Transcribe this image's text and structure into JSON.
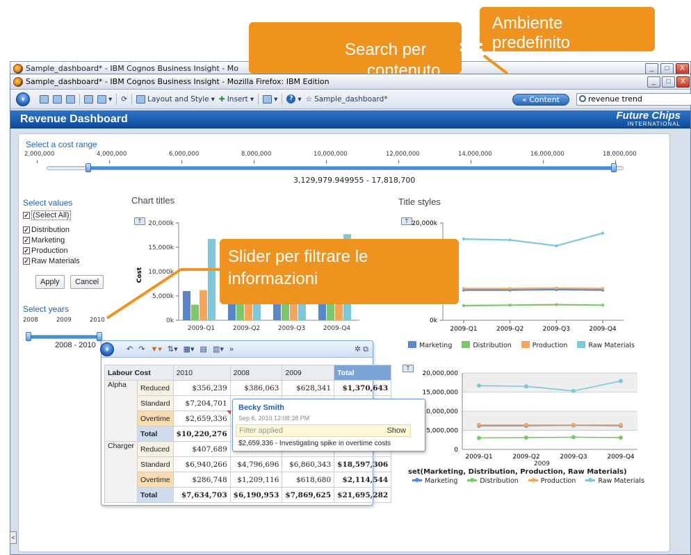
{
  "windows": {
    "back_title": "Sample_dashboard* - IBM Cognos Business Insight - Mo",
    "front_title": "Sample_dashboard* - IBM Cognos Business Insight - Mozilla Firefox: IBM Edition"
  },
  "toolbar": {
    "layout_label": "Layout and Style",
    "insert_label": "Insert",
    "dashboard_name": "Sample_dashboard*",
    "content_label": "« Content",
    "search_value": "revenue trend"
  },
  "dashboard": {
    "title": "Revenue Dashboard",
    "logo_main": "Future Chips",
    "logo_sub": "INTERNATIONAL"
  },
  "cost_range": {
    "label": "Select a cost range",
    "ticks": [
      "2,000,000",
      "4,000,000",
      "6,000,000",
      "8,000,000",
      "10,000,000",
      "12,000,000",
      "14,000,000",
      "16,000,000",
      "18,000,000"
    ],
    "range_text": "3,129,979.949955 - 17,818,700"
  },
  "values_filter": {
    "label": "Select values",
    "items": [
      "(Select All)",
      "Distribution",
      "Marketing",
      "Production",
      "Raw Materials"
    ],
    "apply": "Apply",
    "cancel": "Cancel"
  },
  "years_filter": {
    "label": "Select years",
    "ticks": [
      "2008",
      "2009",
      "2010"
    ],
    "range_text": "2008 - 2010"
  },
  "colors": {
    "marketing": "#5b87c7",
    "distribution": "#7dc66b",
    "production": "#f5a65c",
    "raw_materials": "#7cc7d9",
    "callout": "#f0921e"
  },
  "chart_data": [
    {
      "type": "bar",
      "title": "Chart titles",
      "ylabel": "Cost",
      "categories": [
        "2009-Q1",
        "2009-Q2",
        "2009-Q3",
        "2009-Q4"
      ],
      "y_ticks": [
        "0k",
        "5,000k",
        "10,000k",
        "15,000k",
        "20,000k"
      ],
      "ylim": [
        0,
        20000
      ],
      "series": [
        {
          "name": "Marketing",
          "values": [
            6000,
            6000,
            6000,
            6000
          ]
        },
        {
          "name": "Distribution",
          "values": [
            3200,
            3300,
            3400,
            3300
          ]
        },
        {
          "name": "Production",
          "values": [
            6200,
            6300,
            6400,
            6300
          ]
        },
        {
          "name": "Raw Materials",
          "values": [
            16700,
            16500,
            15300,
            17700
          ]
        }
      ]
    },
    {
      "type": "line",
      "title": "Title styles",
      "categories": [
        "2009-Q1",
        "2009-Q2",
        "2009-Q3",
        "2009-Q4"
      ],
      "y_ticks": [
        "0k",
        "20,000k"
      ],
      "ylim": [
        0,
        20000
      ],
      "series": [
        {
          "name": "Marketing",
          "values": [
            6200,
            6200,
            6300,
            6200
          ]
        },
        {
          "name": "Distribution",
          "values": [
            3000,
            3100,
            3200,
            3100
          ]
        },
        {
          "name": "Production",
          "values": [
            6500,
            6500,
            6600,
            6500
          ]
        },
        {
          "name": "Raw Materials",
          "values": [
            16700,
            16500,
            15300,
            17900
          ]
        }
      ]
    },
    {
      "type": "line",
      "xlabel": "2009",
      "subtitle": "set(Marketing, Distribution, Production, Raw Materials)",
      "categories": [
        "2009-Q1",
        "2009-Q2",
        "2009-Q3",
        "2009-Q4"
      ],
      "y_ticks": [
        "0",
        "5,000,000",
        "10,000,000",
        "15,000,000",
        "20,000,000"
      ],
      "ylim": [
        0,
        20000000
      ],
      "series": [
        {
          "name": "Marketing",
          "values": [
            6200000,
            6200000,
            6300000,
            6200000
          ]
        },
        {
          "name": "Distribution",
          "values": [
            3000000,
            3100000,
            3200000,
            3100000
          ]
        },
        {
          "name": "Production",
          "values": [
            6400000,
            6400000,
            6400000,
            6400000
          ]
        },
        {
          "name": "Raw Materials",
          "values": [
            16700000,
            16500000,
            15300000,
            17900000
          ]
        }
      ]
    }
  ],
  "crosstab": {
    "corner": "Labour Cost",
    "columns": [
      "2010",
      "2008",
      "2009",
      "Total"
    ],
    "rows": [
      {
        "group": "Alpha",
        "label": "Reduced",
        "cells": [
          "$356,239",
          "$386,063",
          "$628,341",
          "$1,370,643"
        ]
      },
      {
        "group": "",
        "label": "Standard",
        "cells": [
          "$7,204,701",
          "$7",
          "",
          ""
        ]
      },
      {
        "group": "",
        "label": "Overtime",
        "cells": [
          "$2,659,336",
          "",
          "",
          ""
        ]
      },
      {
        "group": "",
        "label": "Total",
        "cells": [
          "$10,220,276",
          "$9",
          "",
          ""
        ]
      },
      {
        "group": "Charger",
        "label": "Reduced",
        "cells": [
          "$407,689",
          "",
          "",
          ""
        ]
      },
      {
        "group": "",
        "label": "Standard",
        "cells": [
          "$6,940,266",
          "$4,796,696",
          "$6,860,343",
          "$18,597,306"
        ]
      },
      {
        "group": "",
        "label": "Overtime",
        "cells": [
          "$286,748",
          "$1,209,116",
          "$618,680",
          "$2,114,544"
        ]
      },
      {
        "group": "",
        "label": "Total",
        "cells": [
          "$7,634,703",
          "$6,190,953",
          "$7,869,625",
          "$21,695,282"
        ]
      }
    ]
  },
  "comment": {
    "author": "Becky Smith",
    "date": "Sep 6, 2010 12:08:38 PM",
    "filter_text": "Filter applied",
    "show": "Show",
    "text": "$2,659,336 - Investigating spike in overtime costs"
  },
  "callouts": {
    "ambiente": "Ambiente predefinito",
    "search": "Search per",
    "search_line2": "contenuto",
    "slider": "Slider per filtrare le informazioni"
  }
}
